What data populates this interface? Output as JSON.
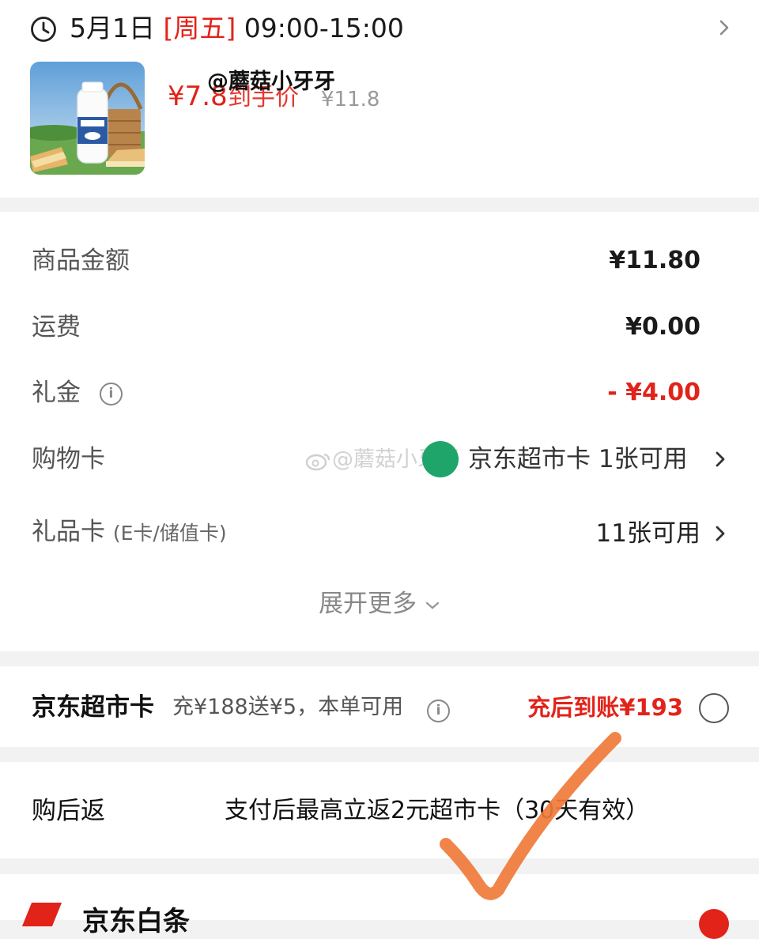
{
  "delivery": {
    "date": "5月1日",
    "weekday": "[周五]",
    "time": "09:00-15:00",
    "price_now": "¥7.8",
    "price_tag": "到手价",
    "price_original": "¥11.8",
    "watermark_top": "@蘑菇小牙牙"
  },
  "fees": {
    "items": [
      {
        "label": "商品金额",
        "value": "¥11.80"
      },
      {
        "label": "运费",
        "value": "¥0.00"
      },
      {
        "label": "礼金",
        "value": "- ¥4.00"
      },
      {
        "label": "购物卡",
        "value": "京东超市卡 1张可用"
      },
      {
        "label": "礼品卡",
        "label_sub": "(E卡/储值卡)",
        "value": "11张可用"
      }
    ],
    "watermark": "@蘑菇小牙牙",
    "expand": "展开更多"
  },
  "jd_card": {
    "title": "京东超市卡",
    "desc": "充¥188送¥5，本单可用",
    "credit": "充后到账¥193"
  },
  "after_purchase": {
    "label": "购后返",
    "desc": "支付后最高立返2元超市卡（30天有效）"
  },
  "bottom": {
    "title": "京东白条"
  },
  "colors": {
    "accent": "#e2231a",
    "muted": "#999999",
    "annotation": "#f07a3a"
  }
}
